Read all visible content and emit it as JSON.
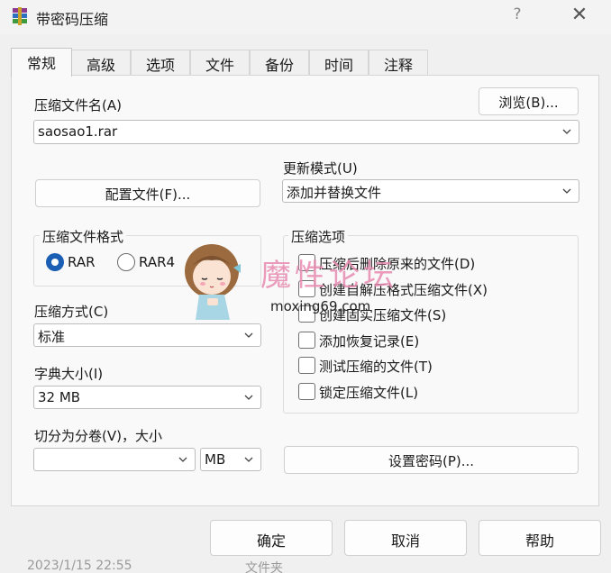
{
  "window": {
    "title": "带密码压缩",
    "help_glyph": "?",
    "close_glyph": "✕"
  },
  "tabs": [
    {
      "label": "常规",
      "active": true
    },
    {
      "label": "高级"
    },
    {
      "label": "选项"
    },
    {
      "label": "文件"
    },
    {
      "label": "备份"
    },
    {
      "label": "时间"
    },
    {
      "label": "注释"
    }
  ],
  "archive": {
    "name_label": "压缩文件名(A)",
    "browse_label": "浏览(B)...",
    "name_value": "saosao1.rar"
  },
  "profiles": {
    "button_label": "配置文件(F)..."
  },
  "update_mode": {
    "label": "更新模式(U)",
    "value": "添加并替换文件"
  },
  "format": {
    "group_label": "压缩文件格式",
    "options": [
      {
        "label": "RAR",
        "checked": true
      },
      {
        "label": "RAR4",
        "checked": false
      }
    ]
  },
  "method": {
    "label": "压缩方式(C)",
    "value": "标准"
  },
  "dictionary": {
    "label": "字典大小(I)",
    "value": "32 MB"
  },
  "split": {
    "label": "切分为分卷(V)，大小",
    "value": "",
    "unit": "MB"
  },
  "options": {
    "group_label": "压缩选项",
    "items": [
      {
        "label": "压缩后删除原来的文件(D)",
        "checked": false
      },
      {
        "label": "创建自解压格式压缩文件(X)",
        "checked": false
      },
      {
        "label": "创建固实压缩文件(S)",
        "checked": false
      },
      {
        "label": "添加恢复记录(E)",
        "checked": false
      },
      {
        "label": "测试压缩的文件(T)",
        "checked": false
      },
      {
        "label": "锁定压缩文件(L)",
        "checked": false
      }
    ]
  },
  "password": {
    "button_label": "设置密码(P)..."
  },
  "footer": {
    "ok": "确定",
    "cancel": "取消",
    "help": "帮助"
  },
  "watermark": {
    "title": "魔性论坛",
    "site": "moxing69.com"
  },
  "background_ghost": {
    "date": "2023/1/15 22:55",
    "type": "文件夹"
  },
  "colors": {
    "accent": "#1a5fb4",
    "watermark": "#e88ab0"
  },
  "icons": [
    "winrar-app-icon",
    "chevron-down-icon",
    "mascot-girl-icon"
  ]
}
